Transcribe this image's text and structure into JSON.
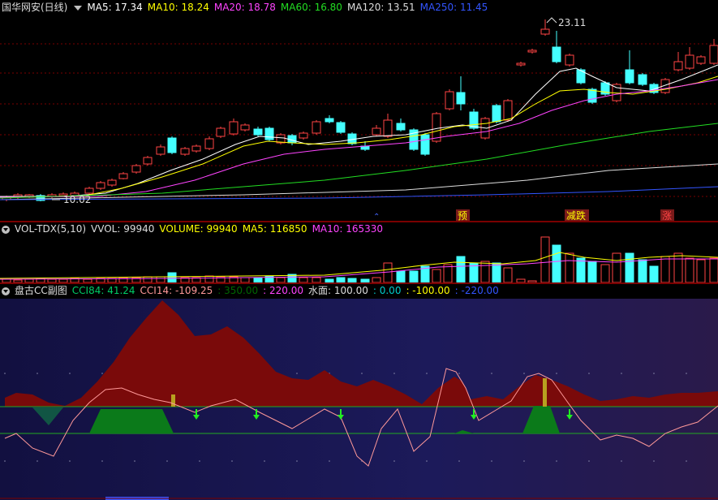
{
  "price_panel": {
    "title": "国华网安(日线)",
    "indicators": [
      {
        "label": "MA5: 17.34",
        "color": "#ffffff"
      },
      {
        "label": "MA10: 18.24",
        "color": "#ffff00"
      },
      {
        "label": "MA20: 18.78",
        "color": "#ff44ff"
      },
      {
        "label": "MA60: 16.80",
        "color": "#22dd22"
      },
      {
        "label": "MA120: 13.51",
        "color": "#dddddd"
      },
      {
        "label": "MA250: 11.45",
        "color": "#3355ff"
      }
    ],
    "high_label": "23.11",
    "low_label": "10.02",
    "signals": [
      {
        "text": "预",
        "color": "#ffff00"
      },
      {
        "text": "减跌",
        "color": "#ffff00"
      },
      {
        "text": "涨",
        "color": "#ff4444"
      }
    ]
  },
  "volume_panel": {
    "indicators": [
      {
        "label": "VOL-TDX(5,10)",
        "color": "#dddddd"
      },
      {
        "label": "VVOL: 99940",
        "color": "#dddddd"
      },
      {
        "label": "VOLUME: 99940",
        "color": "#ffff00"
      },
      {
        "label": "MA5: 116850",
        "color": "#ffff00"
      },
      {
        "label": "MA10: 165330",
        "color": "#ff44ff"
      }
    ]
  },
  "cci_panel": {
    "indicators": [
      {
        "label": "盘古CC副图",
        "color": "#dddddd"
      },
      {
        "label": "CCI84: 41.24",
        "color": "#00cc66"
      },
      {
        "label": "CCI14: -109.25",
        "color": "#ff9999"
      },
      {
        "label": ": 350.00",
        "color": "#006600"
      },
      {
        "label": ": 220.00",
        "color": "#ff44ff"
      },
      {
        "label": "水面: 100.00",
        "color": "#dddddd"
      },
      {
        "label": ": 0.00",
        "color": "#00cccc"
      },
      {
        "label": ": -100.00",
        "color": "#ffff00"
      },
      {
        "label": ": -220.00",
        "color": "#3355ff"
      }
    ]
  },
  "colors": {
    "up": "#ff4444",
    "down": "#44ffff",
    "ma5": "#ffffff",
    "ma10": "#ffff00",
    "ma20": "#ff44ff",
    "ma60": "#22dd22",
    "ma120": "#dddddd",
    "ma250": "#3355ff",
    "cci_area": "#7a0a0a",
    "cci_line": "#ff9999",
    "green_area": "#0b7a1a"
  }
}
